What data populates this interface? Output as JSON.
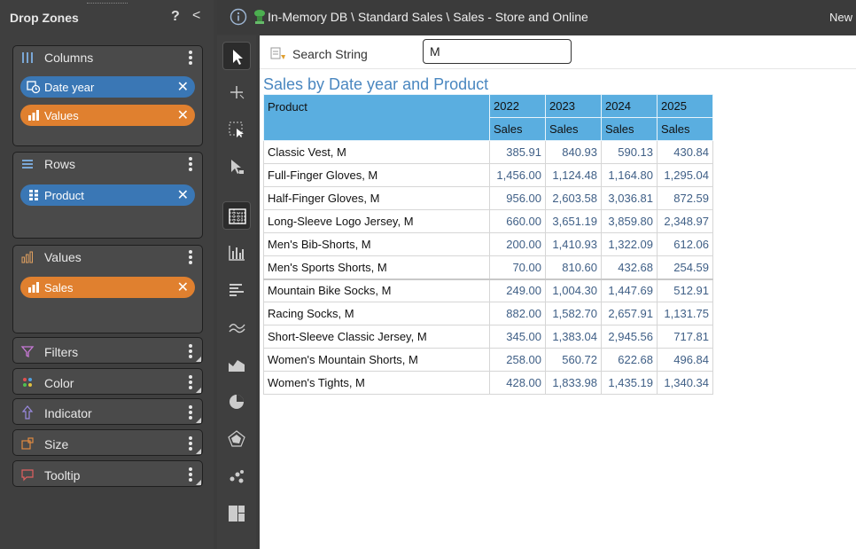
{
  "left_panel": {
    "title": "Drop Zones",
    "help": "?",
    "collapse": "<",
    "zones": {
      "columns": {
        "label": "Columns",
        "items": [
          {
            "label": "Date year",
            "color": "#3a77b5"
          },
          {
            "label": "Values",
            "color": "#e0802f"
          }
        ]
      },
      "rows": {
        "label": "Rows",
        "items": [
          {
            "label": "Product",
            "color": "#3a77b5"
          }
        ]
      },
      "values": {
        "label": "Values",
        "items": [
          {
            "label": "Sales",
            "color": "#e0802f"
          }
        ]
      },
      "filters": {
        "label": "Filters"
      },
      "color": {
        "label": "Color"
      },
      "indicator": {
        "label": "Indicator"
      },
      "size": {
        "label": "Size"
      },
      "tooltip": {
        "label": "Tooltip"
      }
    }
  },
  "topbar": {
    "breadcrumb": "In-Memory DB \\ Standard Sales \\ Sales - Store and Online",
    "new_label": "New"
  },
  "search": {
    "label": "Search String",
    "value": "M"
  },
  "report": {
    "title": "Sales by Date year and Product",
    "row_header": "Product",
    "years": [
      "2022",
      "2023",
      "2024",
      "2025"
    ],
    "measure": "Sales",
    "rows": [
      {
        "product": "Classic Vest, M",
        "values": [
          "385.91",
          "840.93",
          "590.13",
          "430.84"
        ]
      },
      {
        "product": "Full-Finger Gloves, M",
        "values": [
          "1,456.00",
          "1,124.48",
          "1,164.80",
          "1,295.04"
        ]
      },
      {
        "product": "Half-Finger Gloves, M",
        "values": [
          "956.00",
          "2,603.58",
          "3,036.81",
          "872.59"
        ]
      },
      {
        "product": "Long-Sleeve Logo Jersey, M",
        "values": [
          "660.00",
          "3,651.19",
          "3,859.80",
          "2,348.97"
        ]
      },
      {
        "product": "Men's Bib-Shorts, M",
        "values": [
          "200.00",
          "1,410.93",
          "1,322.09",
          "612.06"
        ]
      },
      {
        "product": "Men's Sports Shorts, M",
        "values": [
          "70.00",
          "810.60",
          "432.68",
          "254.59"
        ]
      },
      {
        "product": "Mountain Bike Socks, M",
        "values": [
          "249.00",
          "1,004.30",
          "1,447.69",
          "512.91"
        ]
      },
      {
        "product": "Racing Socks, M",
        "values": [
          "882.00",
          "1,582.70",
          "2,657.91",
          "1,131.75"
        ]
      },
      {
        "product": "Short-Sleeve Classic Jersey, M",
        "values": [
          "345.00",
          "1,383.04",
          "2,945.56",
          "717.81"
        ]
      },
      {
        "product": "Women's Mountain Shorts, M",
        "values": [
          "258.00",
          "560.72",
          "622.68",
          "496.84"
        ]
      },
      {
        "product": "Women's Tights, M",
        "values": [
          "428.00",
          "1,833.98",
          "1,435.19",
          "1,340.34"
        ]
      }
    ]
  },
  "colors": {
    "accent_blue": "#3a77b5",
    "accent_orange": "#e0802f",
    "header_blue": "#5aaee0",
    "title_blue": "#4a87c0"
  },
  "toolbar_tools": [
    "select-pointer-icon",
    "crosshair-icon",
    "lasso-select-icon",
    "drill-pointer-icon",
    "pivot-table-icon",
    "bar-chart-icon",
    "horizontal-bar-icon",
    "line-chart-icon",
    "area-chart-icon",
    "pie-chart-icon",
    "radar-chart-icon",
    "scatter-chart-icon",
    "treemap-icon"
  ]
}
